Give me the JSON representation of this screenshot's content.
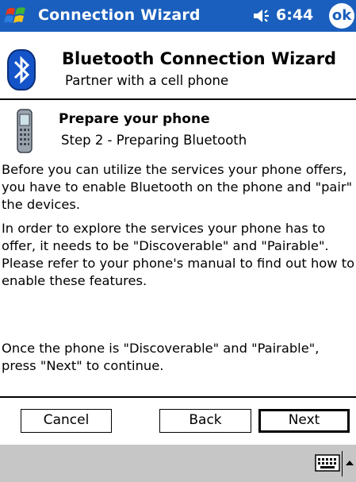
{
  "titlebar": {
    "title": "Connection Wizard",
    "time": "6:44",
    "ok_label": "ok",
    "start_icon": "windows-flag-icon",
    "volume_icon": "speaker-icon"
  },
  "wizard": {
    "title": "Bluetooth Connection Wizard",
    "subtitle": "Partner with a cell phone",
    "icon": "bluetooth-icon"
  },
  "step": {
    "title": "Prepare your phone",
    "subtitle": "Step 2 - Preparing Bluetooth",
    "icon": "cell-phone-icon"
  },
  "body": {
    "paragraph1": "Before you can utilize the services your phone offers, you have to enable Bluetooth on the phone and \"pair\" the devices.",
    "paragraph2": "In order to explore the services your phone has to offer, it needs to be \"Discoverable\" and \"Pairable\". Please refer to your phone's manual to find out how to enable these features.",
    "paragraph3": "Once the phone is \"Discoverable\" and \"Pairable\", press \"Next\" to continue."
  },
  "buttons": {
    "cancel": "Cancel",
    "back": "Back",
    "next": "Next"
  },
  "menubar": {
    "keyboard_icon": "keyboard-icon",
    "sip_arrow_icon": "arrow-up-icon"
  },
  "colors": {
    "titlebar_bg": "#1a5fbd",
    "menubar_bg": "#c6c6c6",
    "bluetooth_blue": "#1454c8"
  }
}
